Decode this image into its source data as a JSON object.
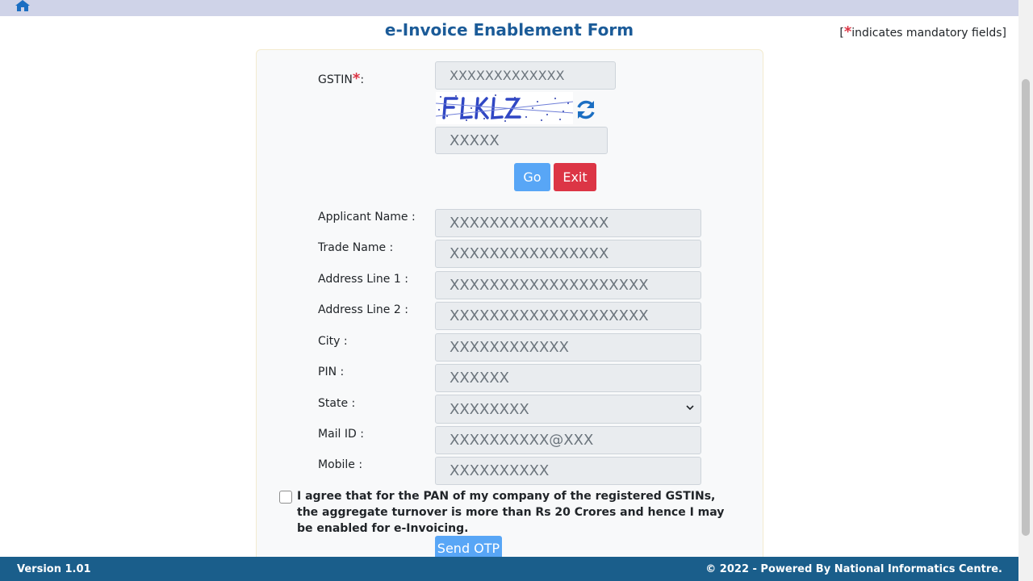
{
  "header": {
    "title": "e-Invoice Enablement Form",
    "mandatory_star": "*",
    "mandatory_note": "indicates mandatory fields"
  },
  "icons": {
    "home": "home-icon",
    "refresh": "refresh-icon",
    "select_arrow": "chevron-down-icon"
  },
  "colors": {
    "title": "#1b5b98",
    "go": "#58a6f6",
    "exit": "#dc3545",
    "footer": "#1a5e8b",
    "topbar": "#cfd3e8"
  },
  "gstin": {
    "label": "GSTIN",
    "required": "*",
    "colon": ":",
    "value": "XXXXXXXXXXXXX"
  },
  "captcha": {
    "value": "XXXXX"
  },
  "buttons": {
    "go": "Go",
    "exit": "Exit",
    "send_otp": "Send OTP"
  },
  "fields": [
    {
      "label": "Applicant Name :",
      "value": "XXXXXXXXXXXXXXXX"
    },
    {
      "label": "Trade Name :",
      "value": "XXXXXXXXXXXXXXXX"
    },
    {
      "label": "Address Line 1 :",
      "value": "XXXXXXXXXXXXXXXXXXXX"
    },
    {
      "label": "Address Line 2 :",
      "value": "XXXXXXXXXXXXXXXXXXXX"
    },
    {
      "label": "City :",
      "value": "XXXXXXXXXXXX"
    },
    {
      "label": "PIN :",
      "value": "XXXXXX"
    },
    {
      "label": "State :",
      "value": "XXXXXXXX"
    },
    {
      "label": "Mail ID :",
      "value": "XXXXXXXXXX@XXX"
    },
    {
      "label": "Mobile :",
      "value": "XXXXXXXXXX"
    }
  ],
  "agreement": {
    "text": "I agree that for the PAN of my company of the registered GSTINs, the aggregate turnover is more than Rs 20 Crores and hence I may be enabled for e-Invoicing."
  },
  "footer": {
    "version": "Version 1.01",
    "copyright": "© 2022 - Powered By National Informatics Centre."
  }
}
